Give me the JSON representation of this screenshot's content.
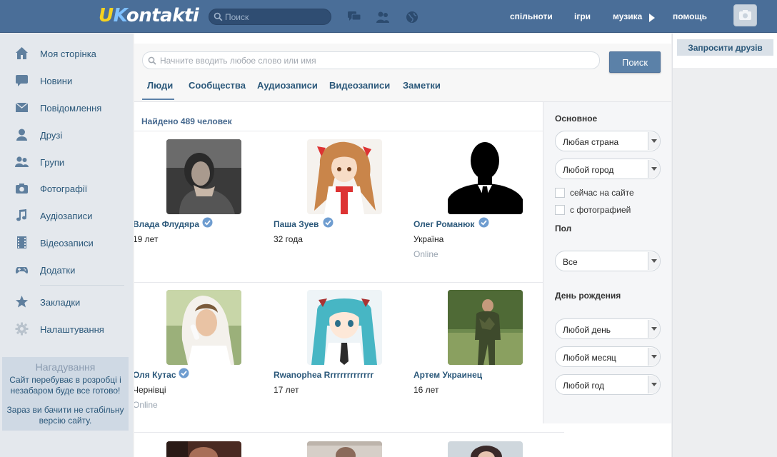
{
  "header": {
    "logo_u": "U",
    "logo_k": "K",
    "logo_rest": "ontakti",
    "search_placeholder": "Поиск",
    "links": {
      "communities": "спільноти",
      "games": "ігри",
      "music": "музика",
      "help": "помощь"
    },
    "icons": [
      "chat-icon",
      "friends-icon",
      "globe-icon",
      "play-icon",
      "camera-icon"
    ]
  },
  "sidebar": {
    "items": [
      {
        "label": "Моя сторінка",
        "icon": "home-icon"
      },
      {
        "label": "Новини",
        "icon": "news-icon"
      },
      {
        "label": "Повідомлення",
        "icon": "messages-icon"
      },
      {
        "label": "Друзі",
        "icon": "friend-icon"
      },
      {
        "label": "Групи",
        "icon": "groups-icon"
      },
      {
        "label": "Фотографії",
        "icon": "photo-camera-icon"
      },
      {
        "label": "Аудіозаписи",
        "icon": "music-note-icon"
      },
      {
        "label": "Відеозаписи",
        "icon": "film-icon"
      },
      {
        "label": "Додатки",
        "icon": "gamepad-icon"
      },
      {
        "label": "Закладки",
        "icon": "star-icon"
      },
      {
        "label": "Налаштування",
        "icon": "gear-icon"
      }
    ],
    "reminder": {
      "title": "Нагадування",
      "text1": "Сайт перебуває в розробці і незабаром буде все готово!",
      "text2": "Зараз ви бачити не стабільну версію сайту."
    }
  },
  "search": {
    "placeholder": "Начните вводить любое слово или имя",
    "button": "Поиск",
    "tabs": [
      "Люди",
      "Сообщества",
      "Аудиозаписи",
      "Видеозаписи",
      "Заметки"
    ],
    "active_tab": "Люди",
    "found": "Найдено 489 человек"
  },
  "people": [
    {
      "name": "Влада Флудяра",
      "verified": true,
      "meta": "19 лет",
      "online": ""
    },
    {
      "name": "Паша Зуев",
      "verified": true,
      "meta": "32 года",
      "online": ""
    },
    {
      "name": "Олег Романюк",
      "verified": true,
      "meta": "Україна",
      "online": "Online"
    },
    {
      "name": "Оля Кутас",
      "verified": true,
      "meta": "Чернівці",
      "online": "Online"
    },
    {
      "name": "Rwanophea Rrrrrrrrrrrrrr",
      "verified": false,
      "meta": "17 лет",
      "online": ""
    },
    {
      "name": "Артем Украинец",
      "verified": false,
      "meta": "16 лет",
      "online": ""
    }
  ],
  "filters": {
    "basic_title": "Основное",
    "country": "Любая страна",
    "city": "Любой город",
    "online_now": "сейчас на сайте",
    "with_photo": "с фотографией",
    "sex_title": "Пол",
    "sex": "Все",
    "birthday_title": "День рождения",
    "day": "Любой день",
    "month": "Любой месяц",
    "year": "Любой год"
  },
  "right": {
    "invite": "Запросити друзів"
  },
  "colors": {
    "topbar": "#4a6e98",
    "link": "#2b587a",
    "button": "#5b81a8",
    "sidebar": "#e4e8ed"
  }
}
